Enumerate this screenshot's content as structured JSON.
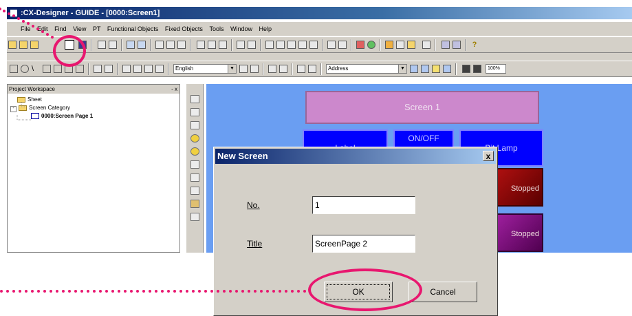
{
  "window": {
    "title": ":CX-Designer - GUIDE - [0000:Screen1]"
  },
  "menubar": {
    "items": [
      "File",
      "Edit",
      "Find",
      "View",
      "PT",
      "Functional Objects",
      "Fixed Objects",
      "Tools",
      "Window",
      "Help"
    ]
  },
  "toolbar": {
    "language_value": "English",
    "address_value": "Address",
    "zoom_value": "100%"
  },
  "workspace": {
    "title": "Project Workspace",
    "controls": "- x",
    "tree": {
      "sheet": "Sheet",
      "screen_category": "Screen Category",
      "screen_page": "0000:Screen Page 1"
    }
  },
  "canvas": {
    "screen_title": "Screen 1",
    "buttons": [
      "Label",
      "ON/OFF",
      "Bit Lamp"
    ],
    "lamp_texts": [
      "Stopped",
      "Stopped"
    ]
  },
  "dialog": {
    "title": "New Screen",
    "close": "x",
    "no_label": "No.",
    "no_value": "1",
    "title_label": "Title",
    "title_value": "ScreenPage 2",
    "ok_label": "OK",
    "cancel_label": "Cancel"
  },
  "colors": {
    "accent_callout": "#e8176f",
    "canvas_bg": "#6a9ef2",
    "titlebar": "#0a246a"
  }
}
